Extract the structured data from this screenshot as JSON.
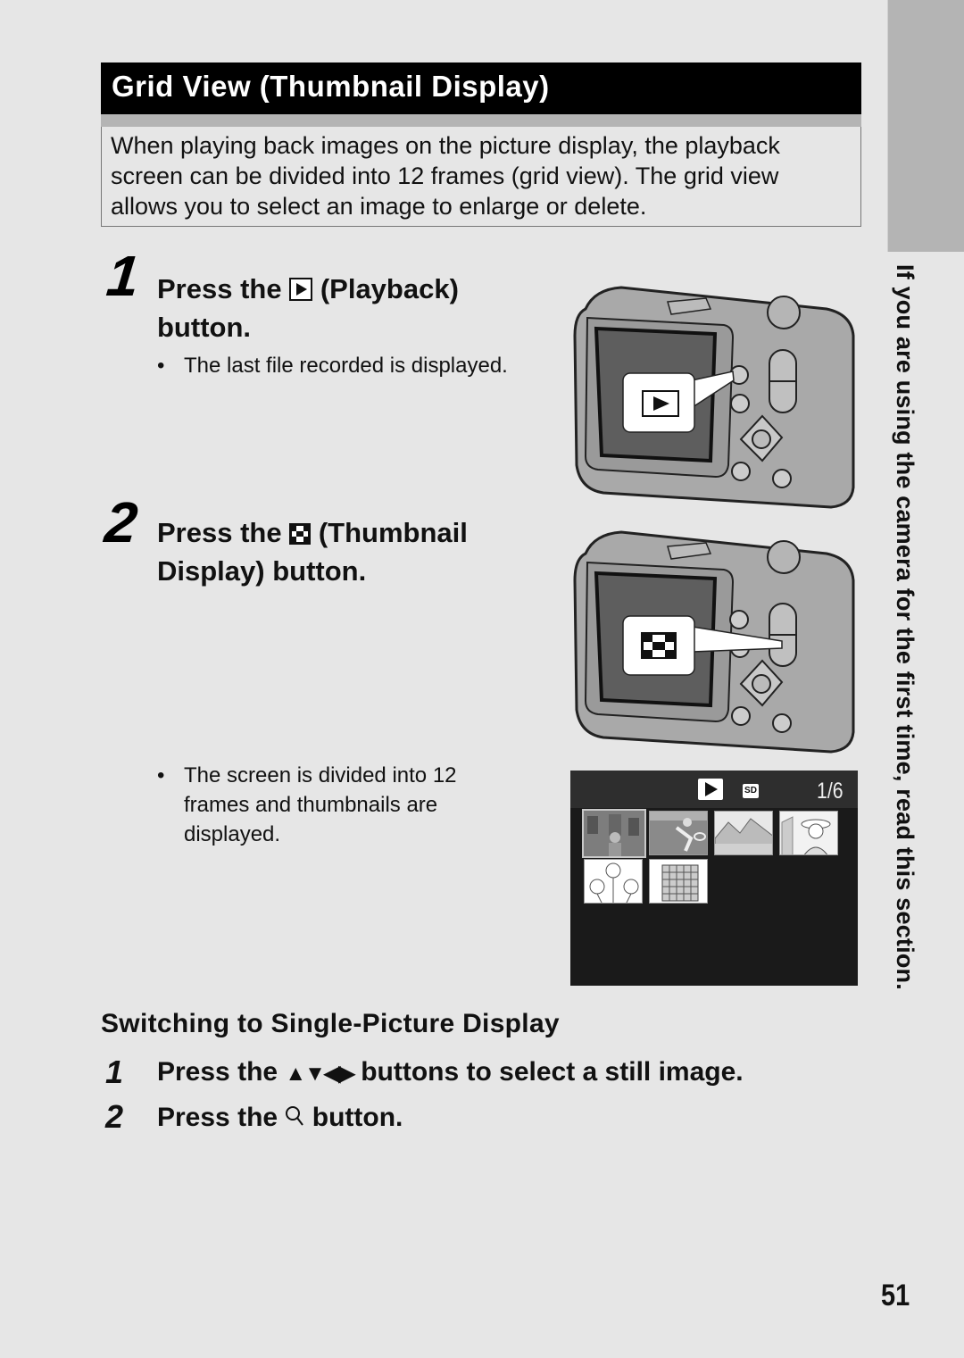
{
  "section_title": "Grid View (Thumbnail Display)",
  "intro": "When playing back images on the picture display, the playback screen can be divided into 12 frames (grid view). The grid view allows you to select an image to enlarge or delete.",
  "side_tab_text": "If you are using the camera for the first time, read this section.",
  "steps": [
    {
      "number": "1",
      "title_before": "Press the",
      "icon": "playback-icon",
      "title_after": "(Playback)",
      "title_line2": "button.",
      "bullet": "The last file recorded is displayed."
    },
    {
      "number": "2",
      "title_before": "Press the",
      "icon": "thumbnail-icon",
      "title_after": "(Thumbnail",
      "title_line2": "Display) button.",
      "bullet_lines": [
        "The screen is divided into 12",
        "frames and thumbnails are",
        "displayed."
      ]
    }
  ],
  "lcd_screen": {
    "mode_icon": "playback-icon",
    "card_icon": "SD",
    "page_counter": "1/6",
    "thumbnails": [
      {
        "subject": "woman-city",
        "selected": true
      },
      {
        "subject": "tennis-player",
        "selected": false
      },
      {
        "subject": "mountains",
        "selected": false
      },
      {
        "subject": "woman-hat-pagoda",
        "selected": false
      },
      {
        "subject": "flowers",
        "selected": false
      },
      {
        "subject": "building",
        "selected": false
      }
    ]
  },
  "subsection": {
    "title": "Switching to Single-Picture Display",
    "steps": [
      {
        "number": "1",
        "before": "Press the",
        "icon": "arrow-keys-icon",
        "glyphs": "▲▼◀▶",
        "after": "buttons to select a still image."
      },
      {
        "number": "2",
        "before": "Press the",
        "icon": "zoom-magnifier-icon",
        "glyphs": "⚲",
        "after": "button."
      }
    ]
  },
  "page_number": "51"
}
